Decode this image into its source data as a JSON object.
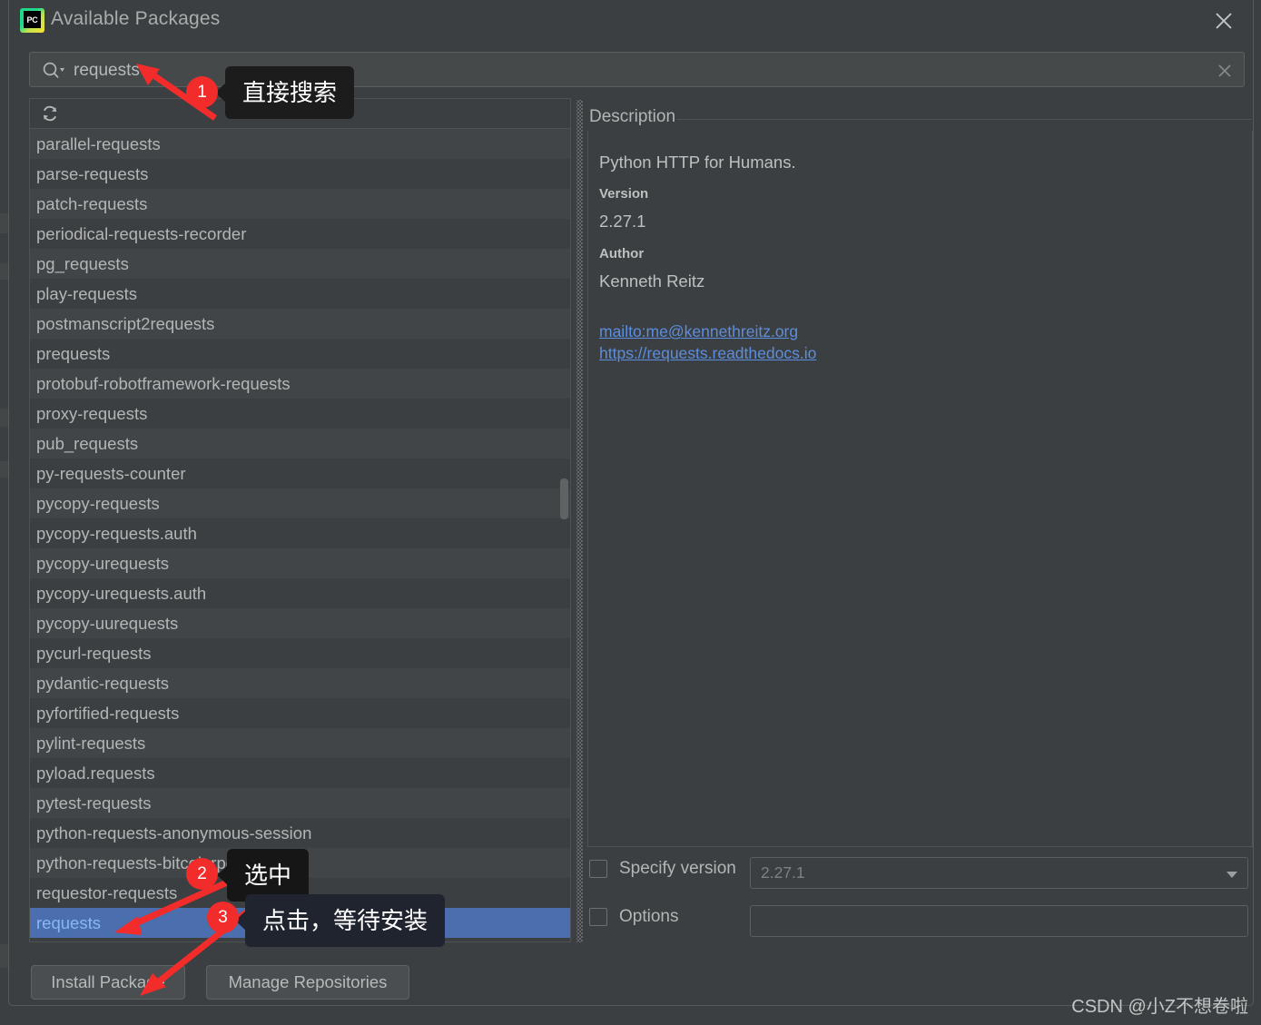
{
  "window": {
    "title": "Available Packages",
    "icon": "pycharm-logo-icon",
    "close_icon": "close-icon"
  },
  "search": {
    "value": "requests",
    "placeholder": "",
    "icon": "search-icon",
    "clear_icon": "clear-icon"
  },
  "list": {
    "refresh_icon": "refresh-icon",
    "selected": "requests",
    "items": [
      "parallel-requests",
      "parse-requests",
      "patch-requests",
      "periodical-requests-recorder",
      "pg_requests",
      "play-requests",
      "postmanscript2requests",
      "prequests",
      "protobuf-robotframework-requests",
      "proxy-requests",
      "pub_requests",
      "py-requests-counter",
      "pycopy-requests",
      "pycopy-requests.auth",
      "pycopy-urequests",
      "pycopy-urequests.auth",
      "pycopy-uurequests",
      "pycurl-requests",
      "pydantic-requests",
      "pyfortified-requests",
      "pylint-requests",
      "pyload.requests",
      "pytest-requests",
      "python-requests-anonymous-session",
      "python-requests-bitcoinrpc",
      "requestor-requests",
      "requests"
    ]
  },
  "description": {
    "header": "Description",
    "summary": "Python HTTP for Humans.",
    "version_label": "Version",
    "version_value": "2.27.1",
    "author_label": "Author",
    "author_value": "Kenneth Reitz",
    "links": [
      "mailto:me@kennethreitz.org",
      "https://requests.readthedocs.io"
    ]
  },
  "options": {
    "specify_version_label": "Specify version",
    "specify_version_checked": false,
    "version_select_value": "2.27.1",
    "options_label": "Options",
    "options_checked": false,
    "options_value": ""
  },
  "buttons": {
    "install": "Install Package",
    "manage": "Manage Repositories"
  },
  "annotations": [
    {
      "number": "1",
      "text": "直接搜索"
    },
    {
      "number": "2",
      "text": "选中"
    },
    {
      "number": "3",
      "text": "点击，等待安装"
    }
  ],
  "watermark": "CSDN @小Z不想卷啦",
  "colors": {
    "dialog_bg": "#3c3f41",
    "row_alt": "#414547",
    "selection": "#4b6eaf",
    "selection_text": "#87b7f5",
    "link": "#5b8ede",
    "badge": "#f22b2b",
    "text": "#b3b6b6"
  }
}
